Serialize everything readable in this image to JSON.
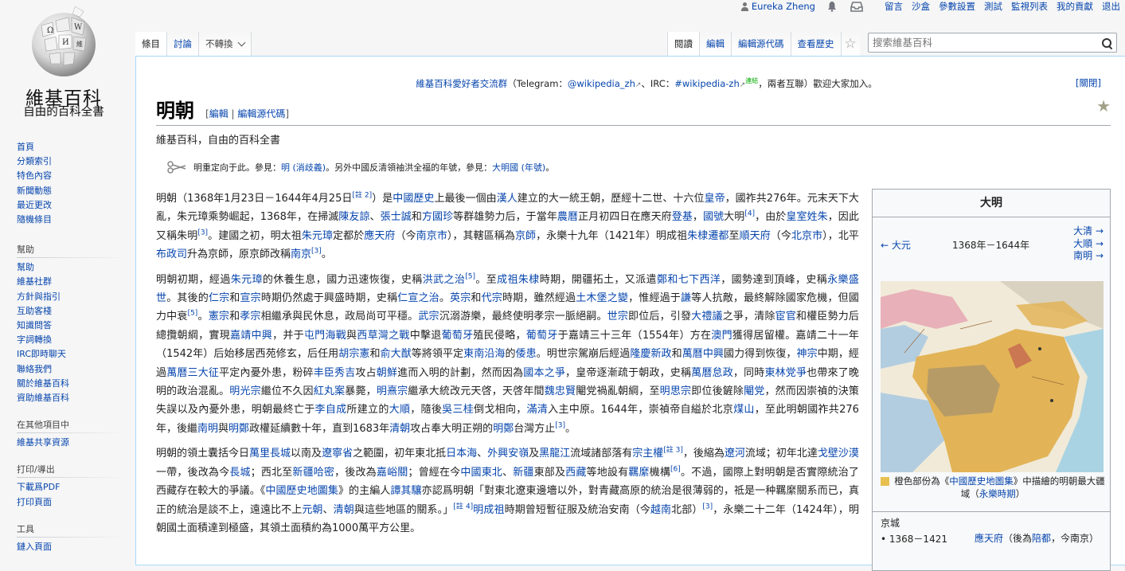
{
  "personal": {
    "username": "Eureka Zheng",
    "links": [
      "留言",
      "沙盒",
      "參數設置",
      "測試",
      "監視列表",
      "我的貢獻",
      "退出"
    ]
  },
  "logo": {
    "wordmark": "維基百科",
    "tagline": "自由的百科全書",
    "globe_letters": [
      "Ω",
      "W",
      "И",
      "維"
    ]
  },
  "sidebar": {
    "main_links": [
      "首頁",
      "分類索引",
      "特色內容",
      "新聞動態",
      "最近更改",
      "隨機條目"
    ],
    "help_heading": "幫助",
    "help_links": [
      "幫助",
      "維基社群",
      "方針與指引",
      "互助客棧",
      "知識問答",
      "字詞轉換",
      "IRC即時聊天",
      "聯絡我們",
      "關於維基百科",
      "資助維基百科"
    ],
    "other_heading": "在其他項目中",
    "other_links": [
      "維基共享資源"
    ],
    "print_heading": "打印/導出",
    "print_links": [
      "下載爲PDF",
      "打印頁面"
    ],
    "tools_heading": "工具",
    "tools_links": [
      "鏈入頁面"
    ]
  },
  "tabs": {
    "article": "條目",
    "talk": "討論",
    "variant": "不轉換",
    "read": "閱讀",
    "edit": "編輯",
    "edit_source": "編輯源代碼",
    "history": "查看歷史"
  },
  "search": {
    "placeholder": "搜索維基百科"
  },
  "sitenotice": {
    "part1": "維基百科愛好者交流群",
    "part2": "（Telegram：",
    "tg": "@wikipedia_zh",
    "part3": "、IRC：",
    "irc": "#wikipedia-zh",
    "sup": "連結",
    "part4": "，兩者互聯）歡迎大家加入。",
    "dismiss": "[關閉]"
  },
  "heading": {
    "title": "明朝",
    "edit": "編輯",
    "edit_source": "編輯源代碼"
  },
  "site_sub": "維基百科，自由的百科全書",
  "hatnote": {
    "t1": "明重定向于此。參見：",
    "l1": "明 (消歧義)",
    "t2": "。另外中國反清領袖洪全福的年號，參見：",
    "l2": "大明國 (年號)",
    "t3": "。"
  },
  "paragraphs": [
    [
      [
        "t",
        "明朝（1368年1月23日－1644年4月25日"
      ],
      [
        "s",
        "[註 2]"
      ],
      [
        "t",
        "）是"
      ],
      [
        "l",
        "中國歷史"
      ],
      [
        "t",
        "上最後一個由"
      ],
      [
        "l",
        "漢人"
      ],
      [
        "t",
        "建立的大一統王朝，歷經十二世、十六位"
      ],
      [
        "l",
        "皇帝"
      ],
      [
        "t",
        "，國祚共276年。元末天下大亂，朱元璋乘勢崛起，1368年，在掃滅"
      ],
      [
        "l",
        "陳友諒"
      ],
      [
        "t",
        "、"
      ],
      [
        "l",
        "張士誠"
      ],
      [
        "t",
        "和"
      ],
      [
        "l",
        "方國珍"
      ],
      [
        "t",
        "等群雄勢力后，于當年"
      ],
      [
        "l",
        "農曆"
      ],
      [
        "t",
        "正月初四日在應天府"
      ],
      [
        "l",
        "登基"
      ],
      [
        "t",
        "，"
      ],
      [
        "l",
        "國號"
      ],
      [
        "t",
        "大明"
      ],
      [
        "s",
        "[4]"
      ],
      [
        "t",
        "，由於"
      ],
      [
        "l",
        "皇室"
      ],
      [
        "l",
        "姓朱"
      ],
      [
        "t",
        "，因此又稱朱明"
      ],
      [
        "s",
        "[3]"
      ],
      [
        "t",
        "。建國之初，明太祖"
      ],
      [
        "l",
        "朱元璋"
      ],
      [
        "t",
        "定都於"
      ],
      [
        "l",
        "應天府"
      ],
      [
        "t",
        "（今"
      ],
      [
        "l",
        "南京市"
      ],
      [
        "t",
        "），其轄區稱為"
      ],
      [
        "l",
        "京師"
      ],
      [
        "t",
        "，永樂十九年（1421年）明成祖"
      ],
      [
        "l",
        "朱棣"
      ],
      [
        "l",
        "遷都"
      ],
      [
        "t",
        "至"
      ],
      [
        "l",
        "順天府"
      ],
      [
        "t",
        "（今"
      ],
      [
        "l",
        "北京市"
      ],
      [
        "t",
        "），北平"
      ],
      [
        "l",
        "布政司"
      ],
      [
        "t",
        "升為京師，原京師改稱"
      ],
      [
        "l",
        "南京"
      ],
      [
        "s",
        "[3]"
      ],
      [
        "t",
        "。"
      ]
    ],
    [
      [
        "t",
        "明朝初期，經過"
      ],
      [
        "l",
        "朱元璋"
      ],
      [
        "t",
        "的休養生息，國力迅速恢復，史稱"
      ],
      [
        "l",
        "洪武之治"
      ],
      [
        "s",
        "[5]"
      ],
      [
        "t",
        "。至"
      ],
      [
        "l",
        "成祖"
      ],
      [
        "l",
        "朱棣"
      ],
      [
        "t",
        "時期，開疆拓土，又派遣"
      ],
      [
        "l",
        "鄭和"
      ],
      [
        "l",
        "七下西洋"
      ],
      [
        "t",
        "，國勢達到頂峰，史稱"
      ],
      [
        "l",
        "永樂盛世"
      ],
      [
        "t",
        "。其後的"
      ],
      [
        "l",
        "仁宗"
      ],
      [
        "t",
        "和"
      ],
      [
        "l",
        "宣宗"
      ],
      [
        "t",
        "時期仍然處于興盛時期，史稱"
      ],
      [
        "l",
        "仁宣之治"
      ],
      [
        "t",
        "。"
      ],
      [
        "l",
        "英宗"
      ],
      [
        "t",
        "和"
      ],
      [
        "l",
        "代宗"
      ],
      [
        "t",
        "時期，雖然經過"
      ],
      [
        "l",
        "土木堡之變"
      ],
      [
        "t",
        "，惟經過于"
      ],
      [
        "l",
        "謙"
      ],
      [
        "t",
        "等人抗敵，最終解除國家危機，但國力中衰"
      ],
      [
        "s",
        "[5]"
      ],
      [
        "t",
        "。"
      ],
      [
        "l",
        "憲宗"
      ],
      [
        "t",
        "和"
      ],
      [
        "l",
        "孝宗"
      ],
      [
        "t",
        "相繼承與民休息，政局尚可平穩。"
      ],
      [
        "l",
        "武宗"
      ],
      [
        "t",
        "沉溺游樂，最終使明孝宗一脈絕嗣。"
      ],
      [
        "l",
        "世宗"
      ],
      [
        "t",
        "即位后，引發"
      ],
      [
        "l",
        "大禮議"
      ],
      [
        "t",
        "之爭，清除"
      ],
      [
        "l",
        "宦官"
      ],
      [
        "t",
        "和權臣勢力后總攬朝綱，實現"
      ],
      [
        "l",
        "嘉靖中興"
      ],
      [
        "t",
        "，并于"
      ],
      [
        "l",
        "屯門海戰"
      ],
      [
        "t",
        "與"
      ],
      [
        "l",
        "西草灣之戰"
      ],
      [
        "t",
        "中擊退"
      ],
      [
        "l",
        "葡萄牙"
      ],
      [
        "t",
        "殖民侵略，"
      ],
      [
        "l",
        "葡萄牙"
      ],
      [
        "t",
        "于嘉靖三十三年（1554年）方在"
      ],
      [
        "l",
        "澳門"
      ],
      [
        "t",
        "獲得居留權。嘉靖二十一年（1542年）后始移居西苑修玄，后任用"
      ],
      [
        "l",
        "胡宗憲"
      ],
      [
        "t",
        "和"
      ],
      [
        "l",
        "俞大猷"
      ],
      [
        "t",
        "等將領平定"
      ],
      [
        "l",
        "東南沿海"
      ],
      [
        "t",
        "的"
      ],
      [
        "l",
        "倭患"
      ],
      [
        "t",
        "。明世宗駕崩后經過"
      ],
      [
        "l",
        "隆慶新政"
      ],
      [
        "t",
        "和"
      ],
      [
        "l",
        "萬曆中興"
      ],
      [
        "t",
        "國力得到恢復，"
      ],
      [
        "l",
        "神宗"
      ],
      [
        "t",
        "中期，經過"
      ],
      [
        "l",
        "萬曆三大征"
      ],
      [
        "t",
        "平定內憂外患，粉碎"
      ],
      [
        "l",
        "丰臣秀吉"
      ],
      [
        "t",
        "攻占"
      ],
      [
        "l",
        "朝鮮"
      ],
      [
        "t",
        "進而入明的計劃，然而因為"
      ],
      [
        "l",
        "國本之爭"
      ],
      [
        "t",
        "，皇帝逐漸疏于朝政，史稱"
      ],
      [
        "l",
        "萬曆怠政"
      ],
      [
        "t",
        "，同時"
      ],
      [
        "l",
        "東林党爭"
      ],
      [
        "t",
        "也帶來了晚明的政治混亂。"
      ],
      [
        "l",
        "明光宗"
      ],
      [
        "t",
        "繼位不久因"
      ],
      [
        "l",
        "紅丸案"
      ],
      [
        "t",
        "暴斃，"
      ],
      [
        "l",
        "明熹宗"
      ],
      [
        "t",
        "繼承大統改元天啓，天啓年間"
      ],
      [
        "l",
        "魏忠賢"
      ],
      [
        "t",
        "閹党禍亂朝綱，至"
      ],
      [
        "l",
        "明思宗"
      ],
      [
        "t",
        "即位後鏟除"
      ],
      [
        "l",
        "閹党"
      ],
      [
        "t",
        "，然而因崇禎的決策失誤以及內憂外患，明朝最終亡于"
      ],
      [
        "l",
        "李自成"
      ],
      [
        "t",
        "所建立的"
      ],
      [
        "l",
        "大順"
      ],
      [
        "t",
        "，隨後"
      ],
      [
        "l",
        "吳三桂"
      ],
      [
        "t",
        "倒戈相向，"
      ],
      [
        "l",
        "滿清"
      ],
      [
        "t",
        "入主中原。1644年，崇禎帝自縊於北京"
      ],
      [
        "l",
        "煤山"
      ],
      [
        "t",
        "，至此明朝國祚共276年，後繼"
      ],
      [
        "l",
        "南明"
      ],
      [
        "t",
        "與"
      ],
      [
        "l",
        "明鄭"
      ],
      [
        "t",
        "政權延續數十年，直到1683年"
      ],
      [
        "l",
        "清朝"
      ],
      [
        "t",
        "攻占奉大明正朔的"
      ],
      [
        "l",
        "明鄭"
      ],
      [
        "t",
        "台灣方止"
      ],
      [
        "s",
        "[3]"
      ],
      [
        "t",
        "。"
      ]
    ],
    [
      [
        "t",
        "明朝的領土囊括今日"
      ],
      [
        "l",
        "萬里長城"
      ],
      [
        "t",
        "以南及"
      ],
      [
        "l",
        "遼寧省"
      ],
      [
        "t",
        "之範圍，初年東北抵"
      ],
      [
        "l",
        "日本海"
      ],
      [
        "t",
        "、"
      ],
      [
        "l",
        "外興安嶺"
      ],
      [
        "t",
        "及"
      ],
      [
        "l",
        "黑龍江"
      ],
      [
        "t",
        "流域諸部落有"
      ],
      [
        "l",
        "宗主權"
      ],
      [
        "s",
        "[註 3]"
      ],
      [
        "t",
        "，後縮為"
      ],
      [
        "l",
        "遼河"
      ],
      [
        "t",
        "流域；初年北達"
      ],
      [
        "l",
        "戈壁沙漠"
      ],
      [
        "t",
        "一帶，後改為今"
      ],
      [
        "l",
        "長城"
      ],
      [
        "t",
        "；西北至"
      ],
      [
        "l",
        "新疆哈密"
      ],
      [
        "t",
        "，後改為"
      ],
      [
        "l",
        "嘉峪關"
      ],
      [
        "t",
        "；曾經在今"
      ],
      [
        "l",
        "中國東北"
      ],
      [
        "t",
        "、"
      ],
      [
        "l",
        "新疆"
      ],
      [
        "t",
        "東部及"
      ],
      [
        "l",
        "西藏"
      ],
      [
        "t",
        "等地設有"
      ],
      [
        "l",
        "羈縻"
      ],
      [
        "t",
        "機構"
      ],
      [
        "s",
        "[6]"
      ],
      [
        "t",
        "。不過，國際上對明朝是否實際統治了西藏存在較大的爭議。《"
      ],
      [
        "l",
        "中國歷史地圖集"
      ],
      [
        "t",
        "》的主編人"
      ],
      [
        "l",
        "譚其驤"
      ],
      [
        "t",
        "亦認爲明朝「對東北遼東邊墻以外，對青藏高原的統治是很薄弱的，祗是一种羈縻關系而已，真正的統治是談不上，遠遠比不上"
      ],
      [
        "l",
        "元朝"
      ],
      [
        "t",
        "、"
      ],
      [
        "l",
        "清朝"
      ],
      [
        "t",
        "與這些地區的關系。」"
      ],
      [
        "s",
        "[註 4]"
      ],
      [
        "l",
        "明成祖"
      ],
      [
        "t",
        "時期曾短暫征服及統治安南（今"
      ],
      [
        "l",
        "越南"
      ],
      [
        "t",
        "北部）"
      ],
      [
        "s",
        "[3]"
      ],
      [
        "t",
        "，永樂二十二年（1424年），明朝國土面積達到極盛，其領土面積約為1000萬平方公里。"
      ]
    ]
  ],
  "infobox": {
    "title": "大明",
    "prev": "← 大元",
    "years": "1368年－1644年",
    "next": [
      "大清 →",
      "大順 →",
      "南明 →"
    ],
    "caption_t1": "橙色部份為《",
    "caption_l1": "中國歷史地圖集",
    "caption_t2": "》中描繪的明朝最大疆域（",
    "caption_l2": "永樂時期",
    "caption_t3": "）",
    "capital_label": "京城",
    "capital_years": "• 1368－1421",
    "capital_place_l1": "應天府",
    "capital_place_t1": "（後為",
    "capital_place_l2": "陪都",
    "capital_place_t2": "，今南京）",
    "map_colors": {
      "ming": "#e2b457",
      "sea": "#a9d3e3",
      "land": "#f1ead9",
      "north": "#e8b0b8",
      "west": "#b3cde0",
      "tibet": "#b79b66"
    }
  }
}
